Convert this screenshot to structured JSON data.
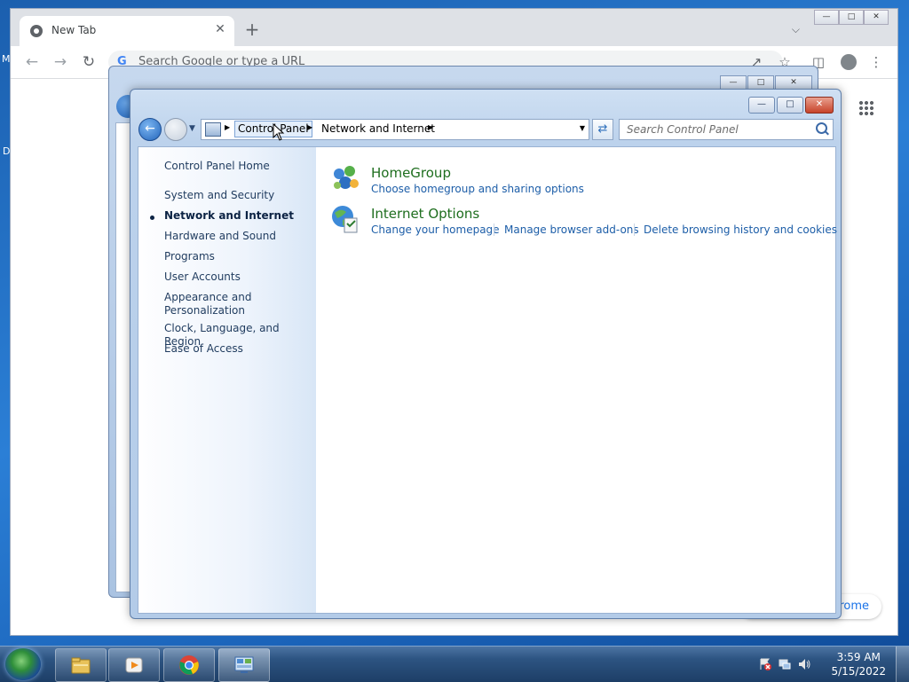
{
  "desktop": {
    "frag_left_1": "M",
    "frag_left_2": "D"
  },
  "chrome": {
    "tab_title": "New Tab",
    "tab_close": "✕",
    "new_tab": "+",
    "omnibox_placeholder": "Search Google or type a URL",
    "customize_label": "rome"
  },
  "control_panel": {
    "breadcrumb": [
      "Control Panel",
      "Network and Internet"
    ],
    "search_placeholder": "Search Control Panel",
    "nav": {
      "home": "Control Panel Home",
      "items": [
        "System and Security",
        "Network and Internet",
        "Hardware and Sound",
        "Programs",
        "User Accounts",
        "Appearance and Personalization",
        "Clock, Language, and Region",
        "Ease of Access"
      ],
      "current_index": 1
    },
    "categories": [
      {
        "title": "HomeGroup",
        "icon": "homegroup-icon",
        "links": [
          "Choose homegroup and sharing options"
        ]
      },
      {
        "title": "Internet Options",
        "icon": "internet-options-icon",
        "links": [
          "Change your homepage",
          "Manage browser add-ons",
          "Delete browsing history and cookies"
        ]
      }
    ]
  },
  "taskbar": {
    "time": "3:59 AM",
    "date": "5/15/2022",
    "pinned": [
      "file-explorer-icon",
      "media-player-icon",
      "chrome-icon",
      "control-panel-icon"
    ]
  }
}
